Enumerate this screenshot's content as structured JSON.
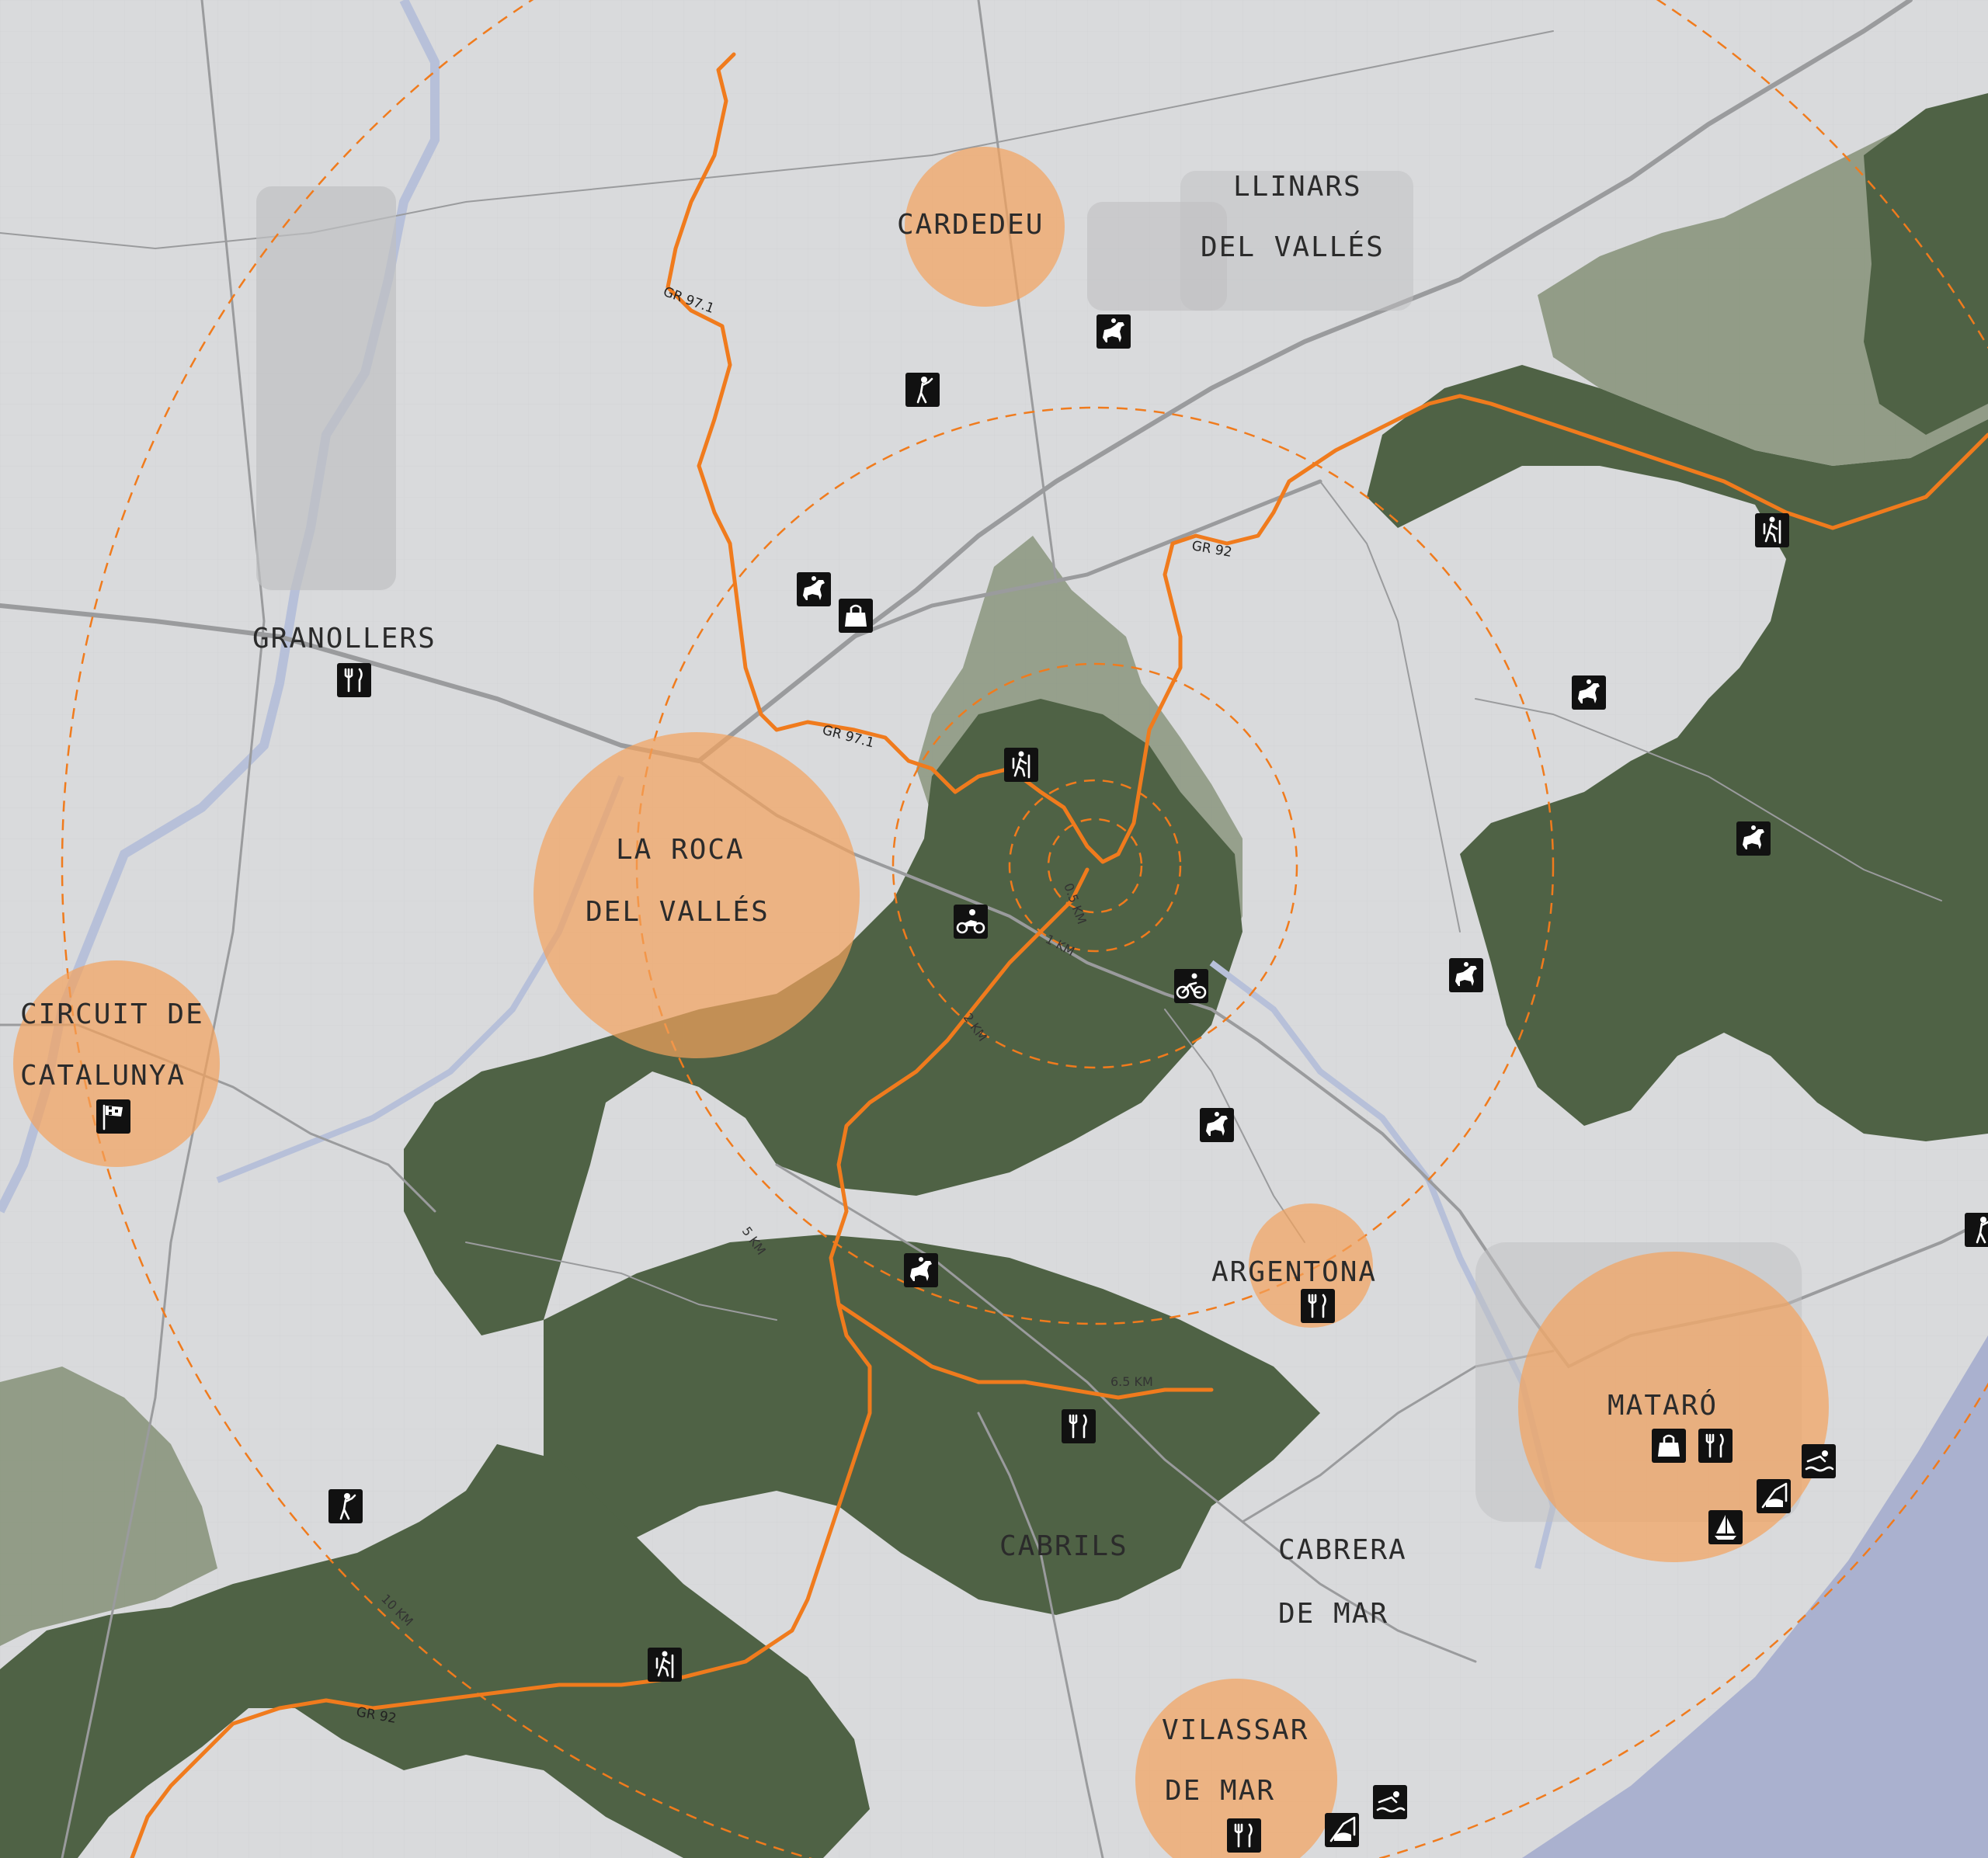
{
  "towns": [
    {
      "id": "cardedeu",
      "lines": [
        "CARDEDEU"
      ]
    },
    {
      "id": "llinars",
      "lines": [
        "LLINARS",
        "DEL VALLÉS"
      ]
    },
    {
      "id": "granollers",
      "lines": [
        "GRANOLLERS"
      ]
    },
    {
      "id": "la-roca",
      "lines": [
        "LA ROCA",
        "DEL VALLÉS"
      ]
    },
    {
      "id": "circuit",
      "lines": [
        "CIRCUIT DE",
        "CATALUNYA"
      ]
    },
    {
      "id": "argentona",
      "lines": [
        "ARGENTONA"
      ]
    },
    {
      "id": "mataro",
      "lines": [
        "MATARÓ"
      ]
    },
    {
      "id": "cabrils",
      "lines": [
        "CABRILS"
      ]
    },
    {
      "id": "cabrera",
      "lines": [
        "CABRERA",
        "DE MAR"
      ]
    },
    {
      "id": "vilassar",
      "lines": [
        "VILASSAR",
        "DE MAR"
      ]
    }
  ],
  "distance_rings": [
    "0.5 KM",
    "1 KM",
    "2 KM",
    "5 KM",
    "6.5 KM",
    "10 KM"
  ],
  "trails": [
    "GR 97.1",
    "GR 92",
    "GR 97.1",
    "GR 92",
    "GR 92"
  ],
  "icons": [
    "horse-riding-icon",
    "golf-icon",
    "horse-riding-icon",
    "shopping-bag-icon",
    "hiking-icon",
    "restaurant-icon",
    "hiking-icon",
    "motorbike-icon",
    "cycling-icon",
    "horse-riding-icon",
    "horse-riding-icon",
    "horse-riding-icon",
    "horse-riding-icon",
    "horse-riding-icon",
    "race-flag-icon",
    "restaurant-icon",
    "restaurant-icon",
    "shopping-bag-icon",
    "restaurant-icon",
    "swimming-icon",
    "fishing-icon",
    "sailing-icon",
    "golf-icon",
    "hiking-icon",
    "restaurant-icon",
    "swimming-icon",
    "fishing-icon",
    "golf-icon"
  ],
  "colors": {
    "background": "#d9dadc",
    "forest": "#4f6245",
    "forest_light": "#7c8b6d",
    "town_circle": "#f3a35d",
    "trail": "#f07b1d",
    "sea": "#aab1cf",
    "road": "#9a9b9d",
    "river": "#b7c0d9"
  }
}
